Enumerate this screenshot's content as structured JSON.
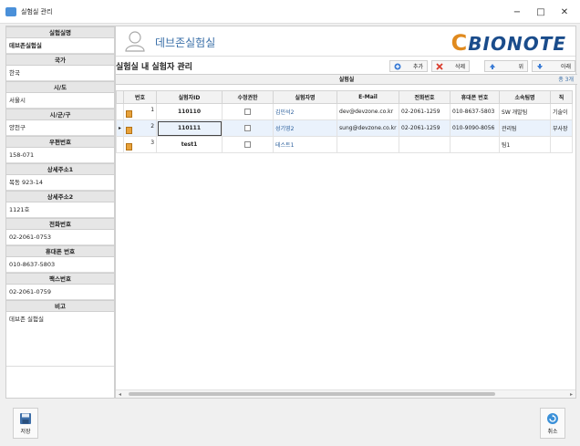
{
  "window": {
    "title": "실험실 관리",
    "controls": [
      "−",
      "□",
      "✕"
    ]
  },
  "left_panel": {
    "fields": [
      {
        "label": "실험실명",
        "value": "데브존실험실",
        "bold": true
      },
      {
        "label": "국가",
        "value": "한국"
      },
      {
        "label": "시/도",
        "value": "서울시"
      },
      {
        "label": "시/군/구",
        "value": "양천구"
      },
      {
        "label": "우편번호",
        "value": "158-071"
      },
      {
        "label": "상세주소1",
        "value": "목동 923-14"
      },
      {
        "label": "상세주소2",
        "value": "1121호"
      },
      {
        "label": "전화번호",
        "value": "02-2061-0753"
      },
      {
        "label": "휴대폰 번호",
        "value": "010-8637-5803"
      },
      {
        "label": "팩스번호",
        "value": "02-2061-0759"
      },
      {
        "label": "비고",
        "value": "데브존 실험실"
      }
    ]
  },
  "header": {
    "lab_name": "데브존실험실",
    "logo": {
      "prefix": "C",
      "text": "BIONOTE"
    }
  },
  "section": {
    "title": "실험실 내 실험자 관리",
    "grid_caption": "실험실",
    "count": "총 3개"
  },
  "toolbar": {
    "add_label": "추가",
    "delete_label": "삭제",
    "up_label": "위",
    "down_label": "아래"
  },
  "table": {
    "columns": [
      "",
      "번호",
      "실험자ID",
      "수정권한",
      "실험자명",
      "E-Mail",
      "전화번호",
      "휴대폰 번호",
      "소속팀명",
      "직"
    ],
    "rows": [
      {
        "no": "1",
        "id": "110110",
        "edit": false,
        "name": "김민석2",
        "email": "dev@devzone.co.kr",
        "phone": "02-2061-1259",
        "mobile": "010-8637-5803",
        "team": "SW 개발팀",
        "rank": "기술이"
      },
      {
        "no": "2",
        "id": "110111",
        "edit": false,
        "name": "성기영2",
        "email": "sung@devzone.co.kr",
        "phone": "02-2061-1259",
        "mobile": "010-9090-8056",
        "team": "관리팀",
        "rank": "부사장"
      },
      {
        "no": "3",
        "id": "test1",
        "edit": false,
        "name": "테스트1",
        "email": "",
        "phone": "",
        "mobile": "",
        "team": "팀1",
        "rank": ""
      }
    ]
  },
  "bottom": {
    "save_label": "저장",
    "cancel_label": "취소"
  },
  "colors": {
    "accent": "#3a6fa8",
    "logo_orange": "#e08a1e",
    "logo_blue": "#1a4c8b",
    "delete_red": "#d93a2b"
  }
}
